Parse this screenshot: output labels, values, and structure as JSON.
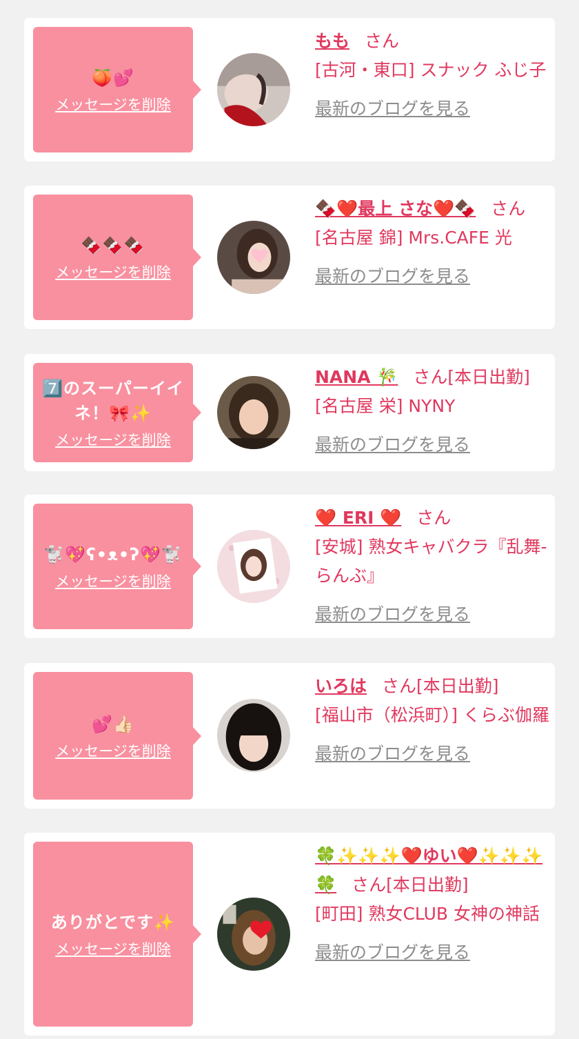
{
  "delete_label": "メッセージを削除",
  "blog_label": "最新のブログを見る",
  "san": "さん",
  "colors": {
    "background": "#f1f1f1",
    "bubble": "#f9909f",
    "accent_pink": "#e0385e",
    "link_gray": "#8c8c8c"
  },
  "messages": [
    {
      "message": "🍑💕",
      "name": "もも",
      "status": "",
      "shop": "[古河・東口] スナック ふじ子"
    },
    {
      "message": "🍫🍫🍫",
      "name": "🍫❤️最上 さな❤️🍫",
      "status": "",
      "shop": "[名古屋 錦] Mrs.CAFE 光"
    },
    {
      "message": "7️⃣のスーパーイイネ！🎀✨",
      "name": "NANA 🎋",
      "status": "[本日出勤]",
      "shop": "[名古屋 栄] NYNY"
    },
    {
      "message": "🐩💖ʕ•ᴥ•ʔ💖🐩",
      "name": "❤️ ERI ❤️",
      "status": "",
      "shop": "[安城] 熟女キャバクラ『乱舞-らんぶ』"
    },
    {
      "message": "💕👍🏻",
      "name": "いろは",
      "status": "[本日出勤]",
      "shop": "[福山市（松浜町）] くらぶ伽羅"
    },
    {
      "message": "ありがとです✨",
      "name": "🍀✨✨✨❤️ゆい❤️✨✨✨🍀",
      "status": "[本日出勤]",
      "shop": "[町田] 熟女CLUB 女神の神話"
    }
  ]
}
